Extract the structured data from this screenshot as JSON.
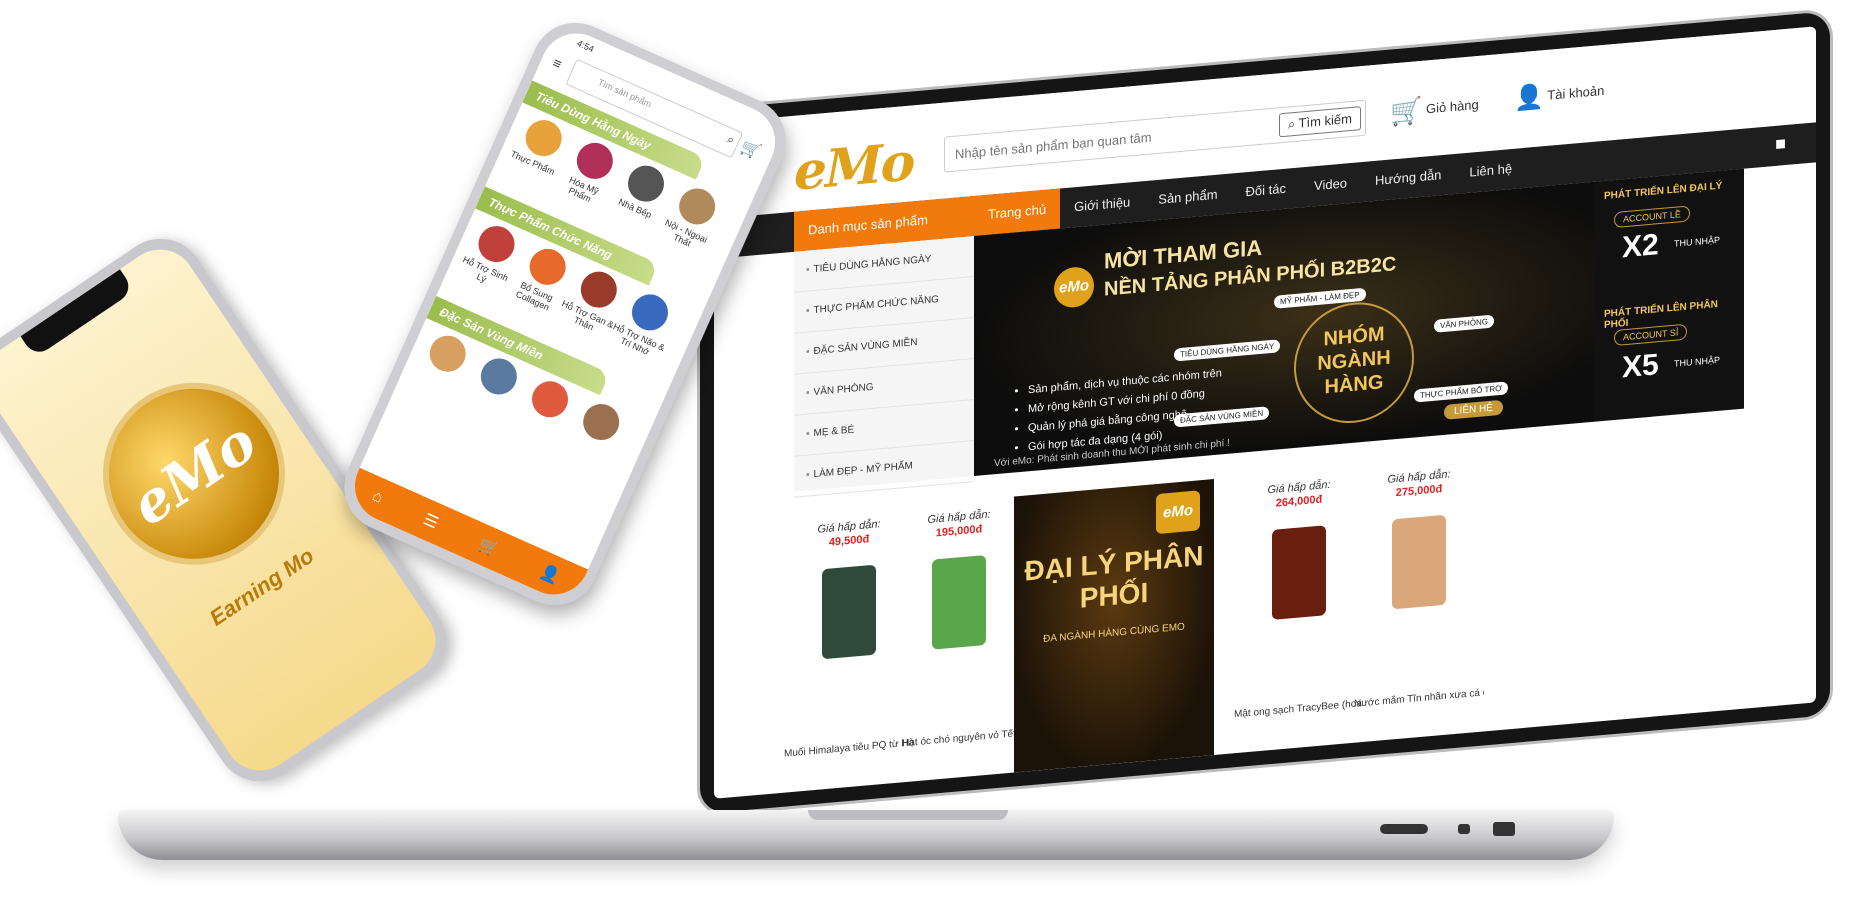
{
  "laptop": {
    "logo": "eMo",
    "search": {
      "placeholder": "Nhập tên sản phẩm bạn quan tâm",
      "button": "Tìm kiếm"
    },
    "cart_label": "Giỏ hàng",
    "account_label": "Tài khoản",
    "nav": {
      "category_label": "Danh mục sản phẩm",
      "links": [
        "Trang chủ",
        "Giới thiệu",
        "Sản phẩm",
        "Đối tác",
        "Video",
        "Hướng dẫn",
        "Liên hệ"
      ]
    },
    "categories": [
      "TIÊU DÙNG HẰNG NGÀY",
      "THỰC PHẨM CHỨC NĂNG",
      "ĐẶC SẢN VÙNG MIỀN",
      "VĂN PHÒNG",
      "MẸ & BÉ",
      "LÀM ĐẸP - MỸ PHẨM"
    ],
    "banner": {
      "logo": "eMo",
      "title": "MỜI THAM GIA",
      "subtitle": "NỀN TẢNG PHÂN PHỐI B2B2C",
      "hub": "NHÓM NGÀNH HÀNG",
      "tags": [
        "MỸ PHẨM - LÀM ĐẸP",
        "TIÊU DÙNG HẰNG NGÀY",
        "VĂN PHÒNG",
        "ĐẶC SẢN VÙNG MIỀN",
        "THỰC PHẨM BỔ TRỢ"
      ],
      "bullets": [
        "Sản phẩm, dịch vụ thuộc các nhóm trên",
        "Mở rộng kênh GT với chi phí 0 đồng",
        "Quản lý phá giá bằng công nghệ",
        "Gói hợp tác đa dạng (4 gói)"
      ],
      "contact": "LIÊN HỆ",
      "footer": "Với eMo: Phát sinh doanh thu MỚI phát sinh chi phí !"
    },
    "promo": {
      "head1": "PHÁT TRIỂN LÊN ĐẠI LÝ",
      "acc1": "ACCOUNT LỀ",
      "mult1": "X2",
      "note1": "THU NHẬP",
      "head2": "PHÁT TRIỂN LÊN PHÂN PHỐI",
      "acc2": "ACCOUNT SỈ",
      "mult2": "X5",
      "note2": "THU NHẬP"
    },
    "products": [
      {
        "price_label": "Giá hấp dẫn:",
        "price": "49,500đ",
        "name": "Muối Himalaya tiêu PQ từ Hàn Quốc",
        "color": "#2f4a3a"
      },
      {
        "price_label": "Giá hấp dẫn:",
        "price": "195,000đ",
        "name": "Hạt óc chó nguyên vỏ Tết",
        "color": "#5aa64a"
      },
      {
        "price_label": "Giá hấp dẫn:",
        "price": "264,000đ",
        "name": "Mật ong sạch TracyBee (hoa chôm",
        "color": "#6a1e0e"
      },
      {
        "price_label": "Giá hấp dẫn:",
        "price": "275,000đ",
        "name": "Nước mắm Tĩn nhãn xưa cá cơm thu",
        "color": "#d9a77a"
      }
    ],
    "agent_banner": {
      "logo": "eMo",
      "title": "ĐẠI LÝ PHÂN PHỐI",
      "subtitle": "ĐA NGÀNH HÀNG CÙNG EMO"
    }
  },
  "phone_back": {
    "logo": "eMo",
    "tagline": "Earning Mo"
  },
  "phone_front": {
    "status": "4:54",
    "search_placeholder": "Tìm sản phẩm",
    "sections": [
      {
        "title": "Tiêu Dùng Hằng Ngày",
        "items": [
          "Thực Phẩm",
          "Hóa Mỹ Phẩm",
          "Nhà Bếp",
          "Nội - Ngoại Thất"
        ]
      },
      {
        "title": "Thực Phẩm Chức Năng",
        "items": [
          "Hỗ Trợ Sinh Lý",
          "Bổ Sung Collagen",
          "Hỗ Trợ Gan & Thận",
          "Hỗ Trợ Não & Trí Nhớ"
        ]
      },
      {
        "title": "Đặc Sản Vùng Miền",
        "items": [
          "",
          "",
          "",
          ""
        ]
      }
    ]
  }
}
